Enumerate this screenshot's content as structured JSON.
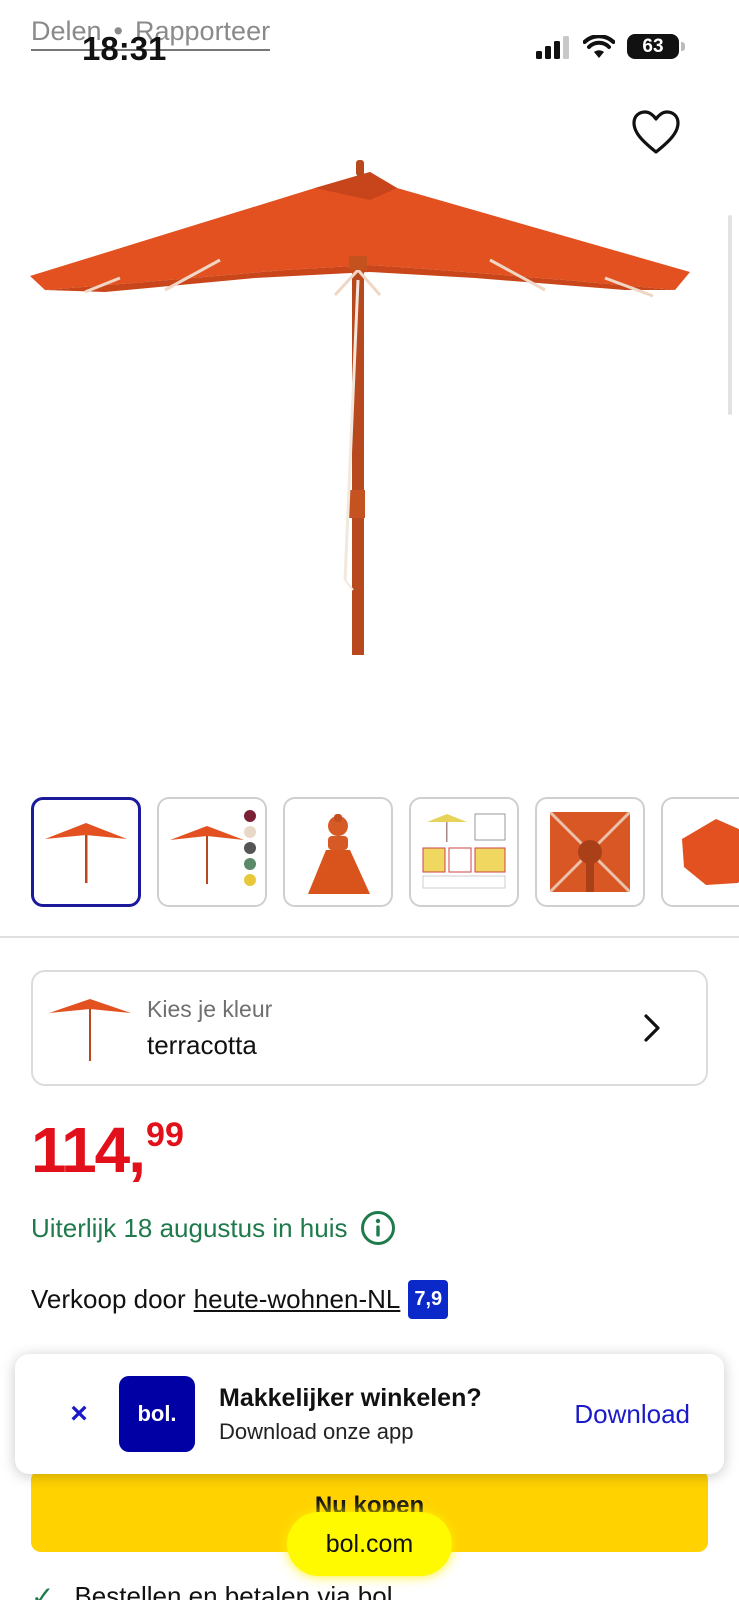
{
  "status_bar": {
    "share_label": "Delen",
    "separator": "•",
    "report_label": "Rapporteer",
    "time": "18:31",
    "battery": "63"
  },
  "color_picker": {
    "label": "Kies je kleur",
    "value": "terracotta"
  },
  "price": {
    "euros": "114,",
    "cents": "99",
    "color": "#e2101a"
  },
  "delivery": {
    "text": "Uiterlijk 18 augustus in huis"
  },
  "seller": {
    "prefix": "Verkoop door",
    "name": "heute-wohnen-NL",
    "score": "7,9"
  },
  "banner": {
    "close": "×",
    "logo": "bol.",
    "title": "Makkelijker winkelen?",
    "subtitle": "Download onze app",
    "download": "Download"
  },
  "buy_button": {
    "label": "Nu kopen"
  },
  "feature": {
    "text": "Bestellen en betalen via bol"
  },
  "browser": {
    "url": "bol.com"
  },
  "thumbnails": [
    {
      "name": "umbrella-thumb-1",
      "active": true
    },
    {
      "name": "umbrella-colors-thumb",
      "swatches": [
        "#7a2235",
        "#e8d8c8",
        "#555555",
        "#5a8a6a",
        "#e8c83a"
      ]
    },
    {
      "name": "umbrella-finial-thumb"
    },
    {
      "name": "umbrella-instructions-thumb"
    },
    {
      "name": "umbrella-ribs-thumb"
    },
    {
      "name": "umbrella-topview-thumb"
    }
  ],
  "colors": {
    "accent": "#1a1ac8",
    "canopy": "#e2511f",
    "buy": "#ffd200",
    "delivery": "#1f7a4c"
  }
}
